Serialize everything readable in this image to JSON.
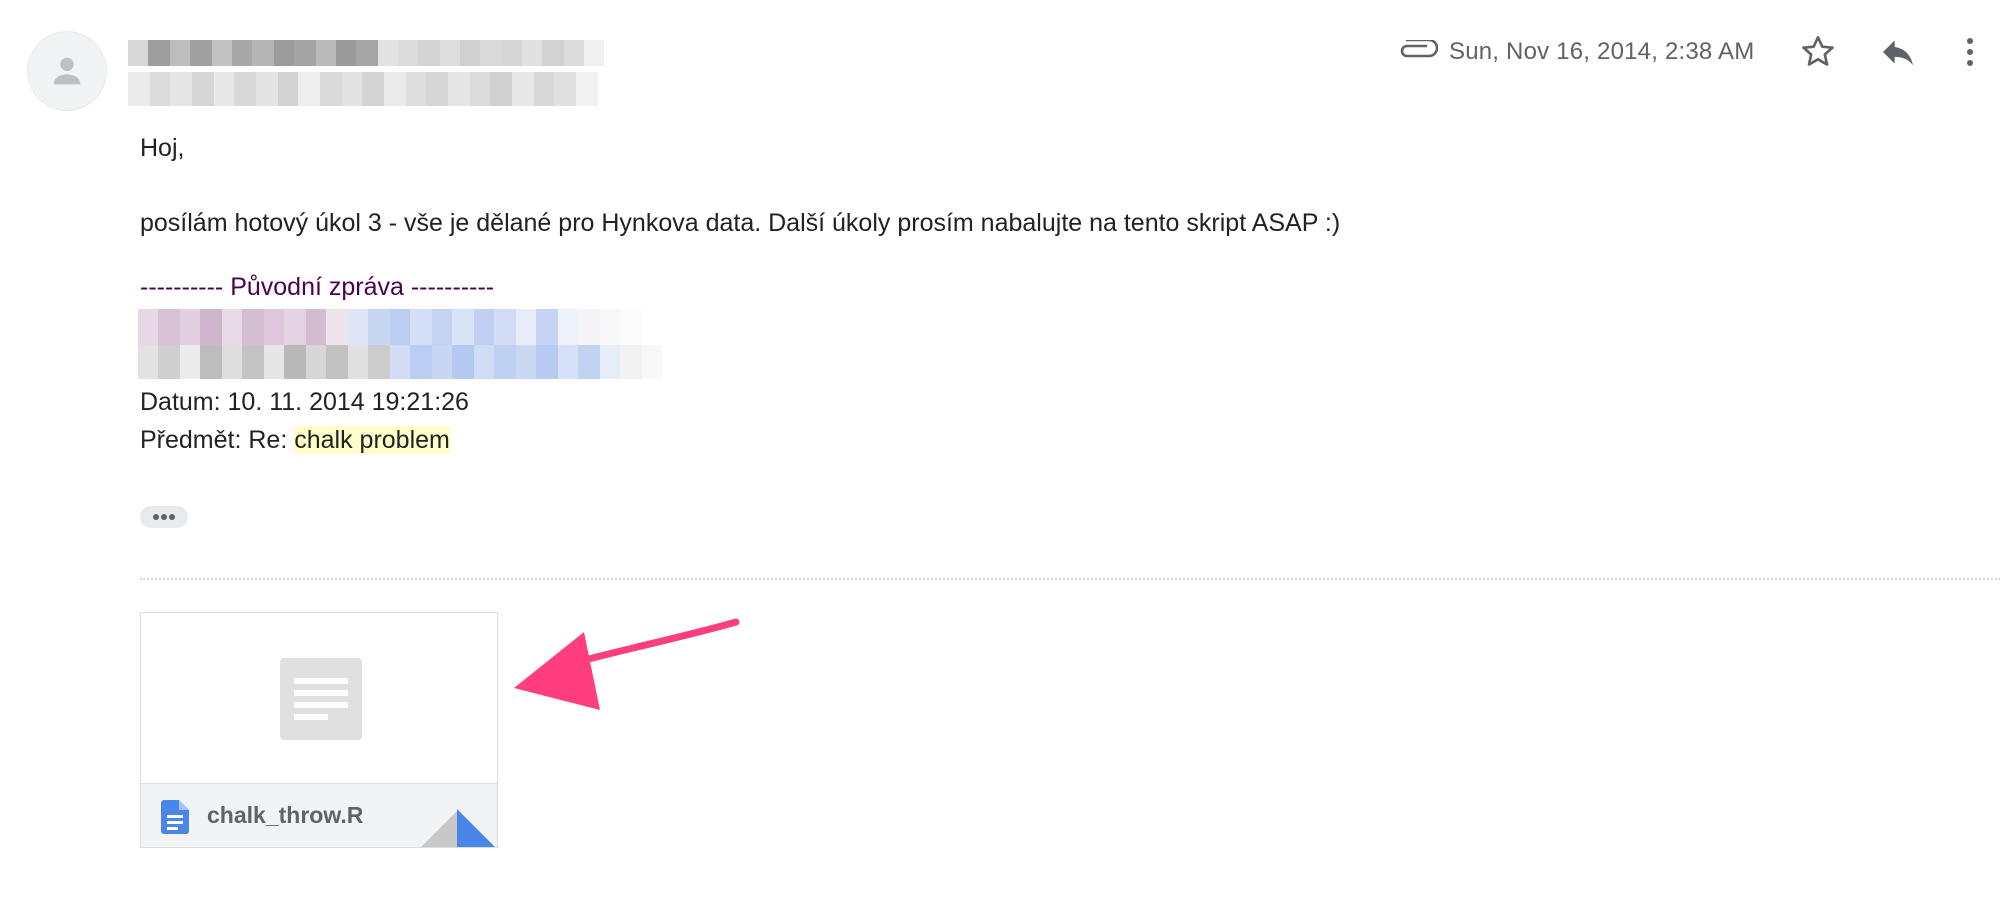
{
  "header": {
    "date": "Sun, Nov 16, 2014, 2:38 AM",
    "icons": [
      "paperclip-icon",
      "star-icon",
      "reply-icon",
      "more-vert-icon"
    ]
  },
  "body": {
    "greeting": "Hoj,",
    "message": "posílám hotový úkol 3 - vše je dělané pro Hynkova data. Další úkoly prosím nabalujte na tento skript ASAP :)",
    "forwarded_header": "---------- Původní zpráva ----------",
    "date_line": "Datum: 10. 11. 2014 19:21:26",
    "subject_prefix": "Předmět: Re: ",
    "subject_highlight": "chalk problem"
  },
  "attachment": {
    "filename": "chalk_throw.R",
    "file_icon": "google-docs-icon"
  },
  "colors": {
    "forwarded": "#500050",
    "highlight": "#ffffcc",
    "annotation_arrow": "#ff3d7f",
    "file_icon_blue": "#4a86e8"
  }
}
